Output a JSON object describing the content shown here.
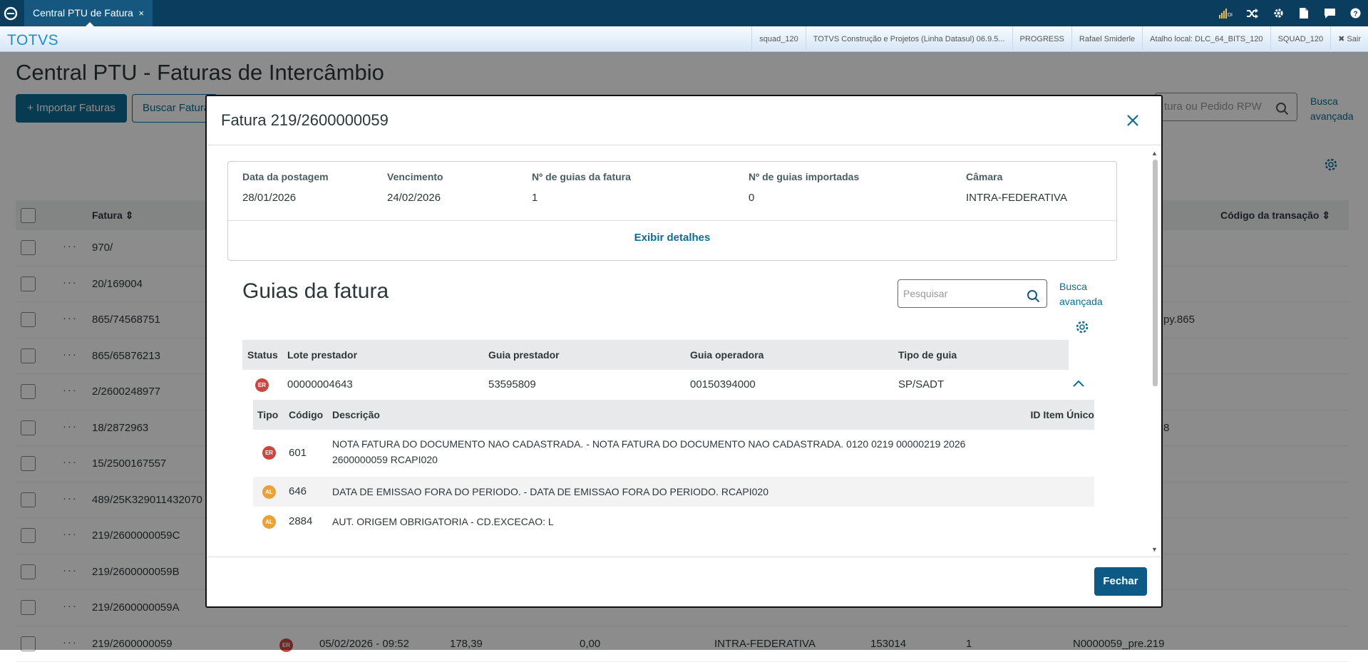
{
  "topbar": {
    "tab_title": "Central PTU de Fatura",
    "tab_close": "×",
    "icons": [
      "signal-icon",
      "shuffle-icon",
      "gear-icon",
      "document-icon",
      "chat-icon",
      "help-icon"
    ],
    "signal_text": "DI"
  },
  "subbar": {
    "brand": "TOTVS",
    "session": [
      "squad_120",
      "TOTVS Construção e Projetos (Linha Datasul) 06.9.5...",
      "PROGRESS",
      "Rafael Smiderle",
      "Atalho local: DLC_64_BITS_120",
      "SQUAD_120"
    ],
    "sair": "✖ Sair"
  },
  "page": {
    "title": "Central PTU - Faturas de Intercâmbio",
    "import_button": "+ Importar Faturas",
    "search_button": "Buscar Faturas",
    "search_placeholder": "tura ou Pedido RPW",
    "busca_avancada": "Busca avançada",
    "table": {
      "col_fatura": "Fatura",
      "col_codigo": "Código da transação",
      "rows": [
        {
          "fatura": "970/",
          "extra": ""
        },
        {
          "fatura": "20/169004",
          "extra": ""
        },
        {
          "fatura": "865/74568751",
          "extra": "py.865"
        },
        {
          "fatura": "865/65876213",
          "extra": ""
        },
        {
          "fatura": "2/2600248977",
          "extra": ""
        },
        {
          "fatura": "18/2872963",
          "extra": "8"
        },
        {
          "fatura": "15/2500167557",
          "extra": ""
        },
        {
          "fatura": "489/25K329011432070",
          "extra": ""
        },
        {
          "fatura": "219/2600000059C",
          "extra": ""
        },
        {
          "fatura": "219/2600000059B",
          "extra": ""
        },
        {
          "fatura": "219/2600000059A",
          "extra": ""
        }
      ],
      "last_row": {
        "fatura": "219/2600000059",
        "status": "ER",
        "data": "05/02/2026 - 09:52",
        "valor1": "178,39",
        "valor2": "0,00",
        "camara": "INTRA-FEDERATIVA",
        "num": "153014",
        "qtd": "1",
        "arquivo": "N0000059_pre.219"
      }
    }
  },
  "modal": {
    "title": "Fatura 219/2600000059",
    "info": [
      {
        "label": "Data da postagem",
        "value": "28/01/2026"
      },
      {
        "label": "Vencimento",
        "value": "24/02/2026"
      },
      {
        "label": "Nº de guias da fatura",
        "value": "1"
      },
      {
        "label": "Nº de guias importadas",
        "value": "0"
      },
      {
        "label": "Câmara",
        "value": "INTRA-FEDERATIVA"
      }
    ],
    "exibir_detalhes": "Exibir detalhes",
    "guias_title": "Guias da fatura",
    "search_placeholder": "Pesquisar",
    "busca_avancada": "Busca avançada",
    "guias_headers": [
      "Status",
      "Lote prestador",
      "Guia prestador",
      "Guia operadora",
      "Tipo de guia"
    ],
    "guia_row": {
      "status": "ER",
      "lote": "00000004643",
      "guia_prestador": "53595809",
      "guia_operadora": "00150394000",
      "tipo": "SP/SADT"
    },
    "sub_headers": [
      "Tipo",
      "Código",
      "Descrição",
      "ID Item Único"
    ],
    "sub_rows": [
      {
        "tipo": "ER",
        "codigo": "601",
        "descricao_1": "NOTA FATURA DO DOCUMENTO NAO CADASTRADA. - NOTA FATURA DO DOCUMENTO NAO CADASTRADA. 0120 0219 00000219 2026",
        "descricao_2": "2600000059 RCAPI020"
      },
      {
        "tipo": "AL",
        "codigo": "646",
        "descricao_1": "DATA DE EMISSAO FORA DO PERIODO. - DATA DE EMISSAO FORA DO PERIODO. RCAPI020",
        "descricao_2": ""
      },
      {
        "tipo": "AL",
        "codigo": "2884",
        "descricao_1": "AUT. ORIGEM OBRIGATORIA - CD.EXCECAO: L",
        "descricao_2": ""
      }
    ],
    "fechar": "Fechar"
  }
}
